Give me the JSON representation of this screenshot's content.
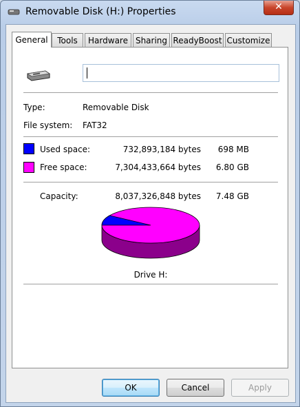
{
  "window": {
    "title": "Removable Disk (H:) Properties",
    "close_label": "✕"
  },
  "tabs": [
    {
      "label": "General"
    },
    {
      "label": "Tools"
    },
    {
      "label": "Hardware"
    },
    {
      "label": "Sharing"
    },
    {
      "label": "ReadyBoost"
    },
    {
      "label": "Customize"
    }
  ],
  "general": {
    "volume_label_value": "",
    "type_label": "Type:",
    "type_value": "Removable Disk",
    "fs_label": "File system:",
    "fs_value": "FAT32",
    "used_label": "Used space:",
    "used_bytes": "732,893,184 bytes",
    "used_size": "698 MB",
    "free_label": "Free space:",
    "free_bytes": "7,304,433,664 bytes",
    "free_size": "6.80 GB",
    "capacity_label": "Capacity:",
    "capacity_bytes": "8,037,326,848 bytes",
    "capacity_size": "7.48 GB",
    "drive_label": "Drive H:",
    "used_fraction": 0.0912
  },
  "colors": {
    "used": "#0000ff",
    "free": "#ff00ff",
    "free_side": "#8b008b",
    "used_side": "#00008b"
  },
  "buttons": {
    "ok": "OK",
    "cancel": "Cancel",
    "apply": "Apply"
  }
}
